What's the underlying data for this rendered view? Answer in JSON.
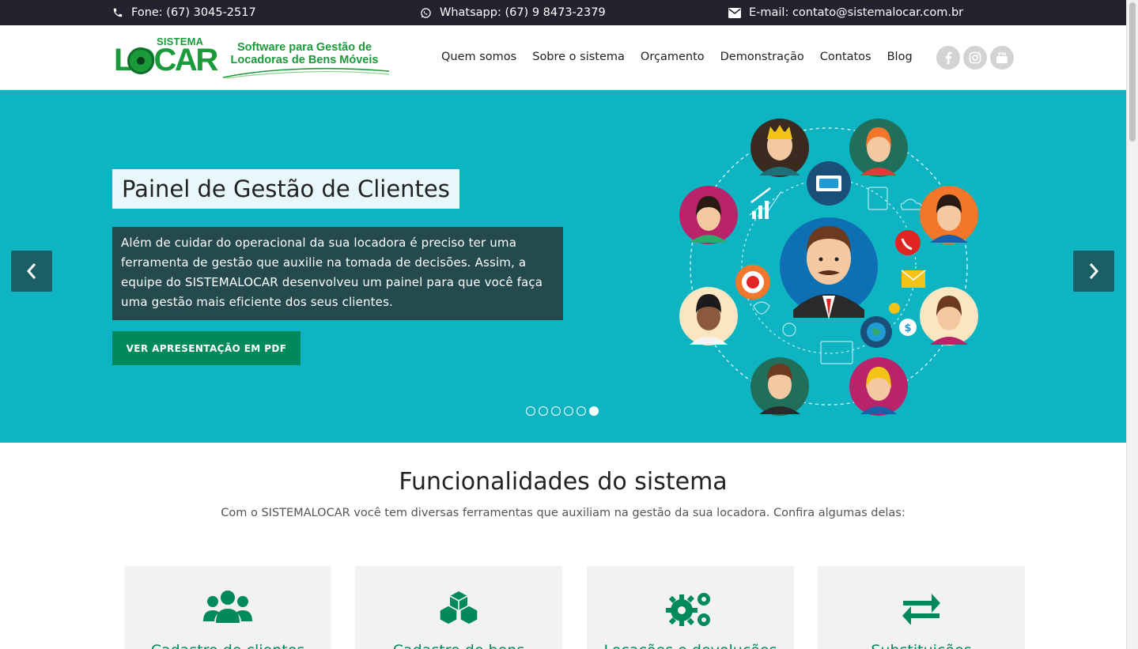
{
  "topbar": {
    "phone": "Fone: (67) 3045-2517",
    "whatsapp": "Whatsapp: (67) 9 8473-2379",
    "email": "E-mail: contato@sistemalocar.com.br",
    "icons": [
      "phone-icon",
      "whatsapp-icon",
      "envelope-icon"
    ]
  },
  "logo": {
    "small": "SISTEMA",
    "big": "LOCAR",
    "tagline_1": "Software para Gestão de",
    "tagline_2": "Locadoras de Bens Móveis",
    "colors": {
      "green": "#1b9a3a"
    }
  },
  "nav": {
    "items": [
      "Quem somos",
      "Sobre o sistema",
      "Orçamento",
      "Demonstração",
      "Contatos",
      "Blog"
    ]
  },
  "social": {
    "icons": [
      "facebook-icon",
      "instagram-icon",
      "youtube-icon"
    ]
  },
  "hero": {
    "title": "Painel de Gestão de Clientes",
    "description": "Além de cuidar do operacional da sua locadora é preciso ter uma ferramenta de gestão que auxilie na tomada de decisões. Assim, a equipe do SISTEMALOCAR desenvolveu um painel para que você faça uma gestão mais eficiente dos seus clientes.",
    "button": "VER APRESENTAÇÃO EM PDF",
    "slides_total": 6,
    "active_slide": 6,
    "colors": {
      "background": "#0fb4c2",
      "button": "#008a5b",
      "desc_bg": "#254a4d"
    }
  },
  "features": {
    "title": "Funcionalidades do sistema",
    "subtitle": "Com o SISTEMALOCAR você tem diversas ferramentas que auxiliam na gestão da sua locadora. Confira algumas delas:",
    "cards": [
      {
        "label": "Cadastro de clientes",
        "icon": "users-icon"
      },
      {
        "label": "Cadastro de bens",
        "icon": "cubes-icon"
      },
      {
        "label": "Locações e devoluções",
        "icon": "gears-icon"
      },
      {
        "label": "Substituições",
        "icon": "exchange-icon"
      }
    ]
  }
}
